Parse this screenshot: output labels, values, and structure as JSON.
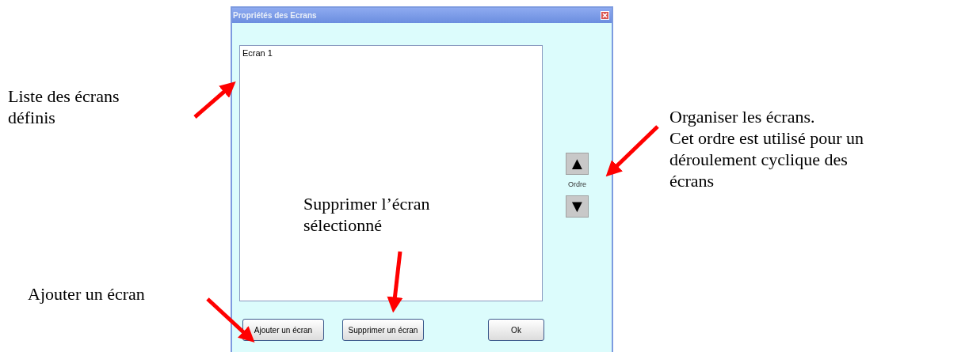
{
  "dialog": {
    "title": "Propriétés des Ecrans",
    "list_items": [
      {
        "label": "Ecran 1",
        "selected": false
      }
    ],
    "order": {
      "up_symbol": "▲",
      "label": "Ordre",
      "down_symbol": "▼"
    },
    "buttons": [
      {
        "kind": "add",
        "label": "Ajouter un écran"
      },
      {
        "kind": "delete",
        "label": "Supprimer un écran"
      },
      {
        "kind": "ok",
        "label": "Ok"
      }
    ]
  },
  "annotations": [
    {
      "kind": "list",
      "lines": [
        "Liste des écrans",
        "définis"
      ]
    },
    {
      "kind": "order",
      "lines": [
        "Organiser les écrans.",
        "Cet ordre est utilisé pour un",
        "déroulement cyclique des",
        "écrans"
      ]
    },
    {
      "kind": "delete",
      "lines": [
        "Supprimer l’écran",
        "sélectionné"
      ]
    },
    {
      "kind": "add",
      "lines": [
        "Ajouter un écran"
      ]
    }
  ]
}
